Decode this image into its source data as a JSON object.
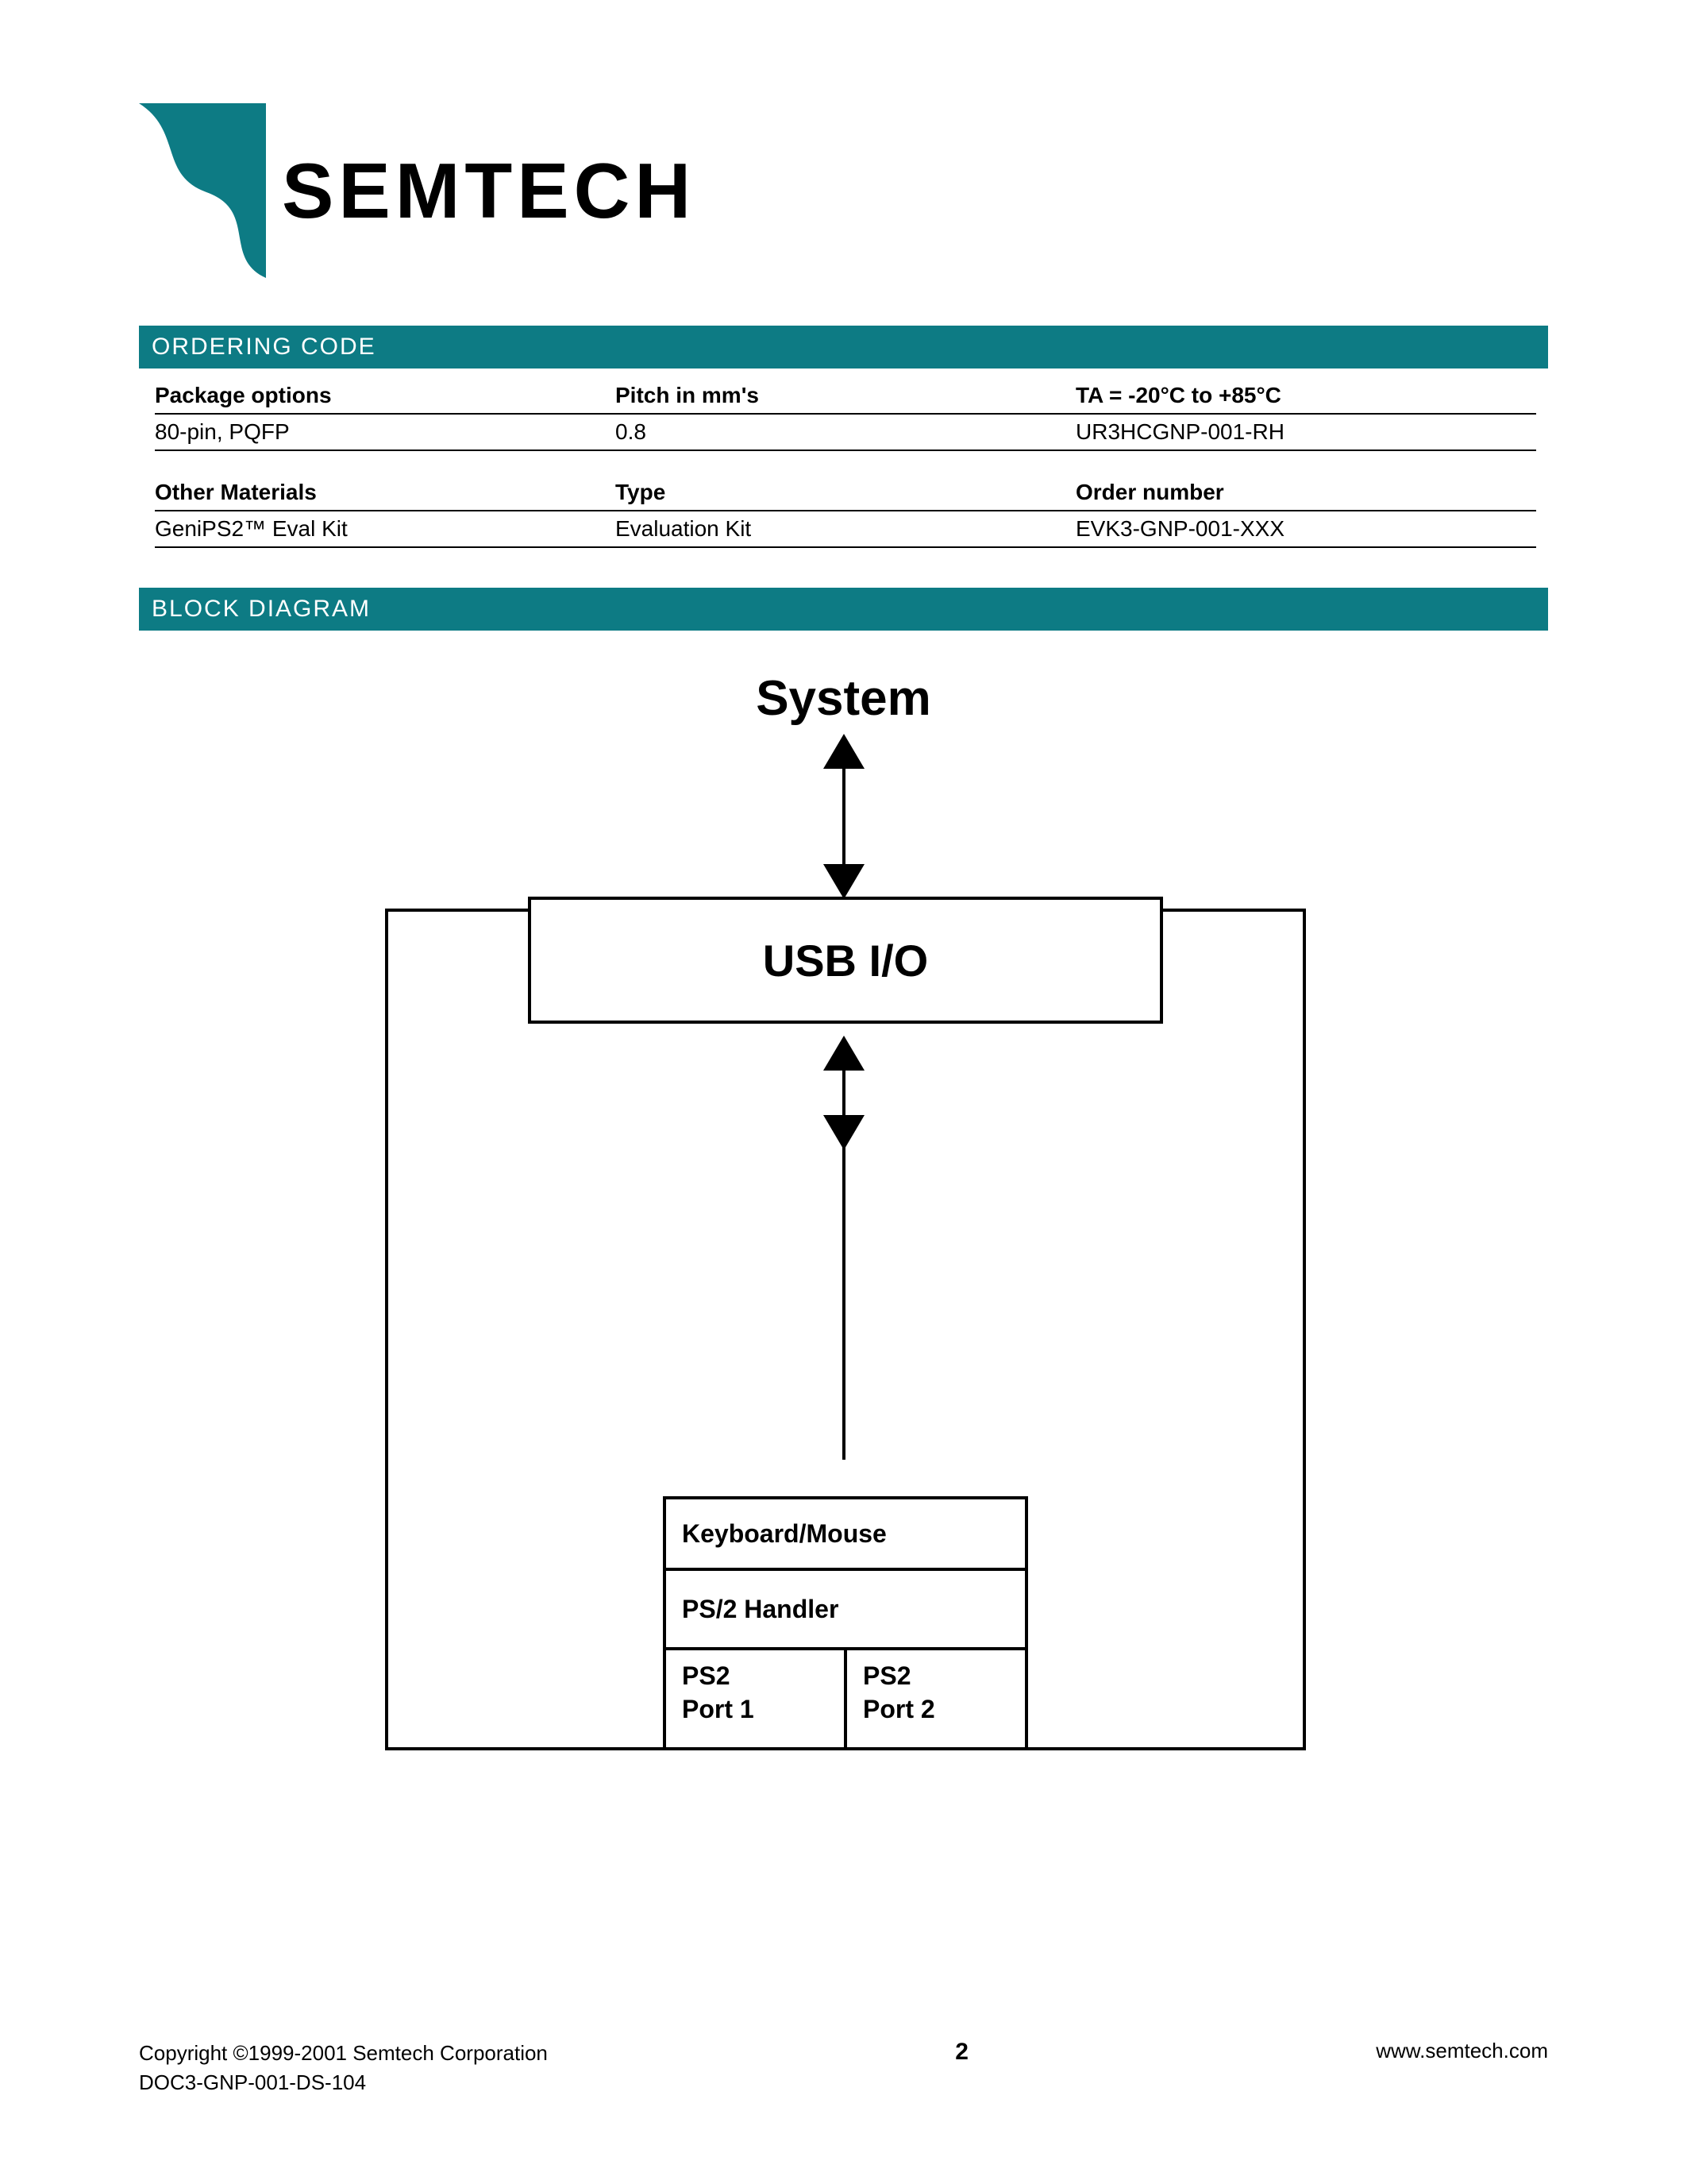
{
  "brand": "SEMTECH",
  "sections": {
    "ordering_code": {
      "title": "ORDERING CODE",
      "table1": {
        "headers": [
          "Package options",
          "Pitch in mm's",
          "TA = -20°C to +85°C"
        ],
        "row": [
          "80-pin, PQFP",
          "0.8",
          "UR3HCGNP-001-RH"
        ]
      },
      "table2": {
        "headers": [
          "Other Materials",
          "Type",
          "Order number"
        ],
        "row": [
          "GeniPS2™ Eval Kit",
          "Evaluation Kit",
          "EVK3-GNP-001-XXX"
        ]
      }
    },
    "block_diagram": {
      "title": "BLOCK DIAGRAM",
      "system_label": "System",
      "usb_label": "USB I/O",
      "kbm": {
        "top": "Keyboard/Mouse",
        "mid": "PS/2 Handler",
        "port1_line1": "PS2",
        "port1_line2": "Port 1",
        "port2_line1": "PS2",
        "port2_line2": "Port 2"
      }
    }
  },
  "footer": {
    "copyright": "Copyright ©1999-2001 Semtech Corporation",
    "docid": "DOC3-GNP-001-DS-104",
    "page": "2",
    "url": "www.semtech.com"
  }
}
